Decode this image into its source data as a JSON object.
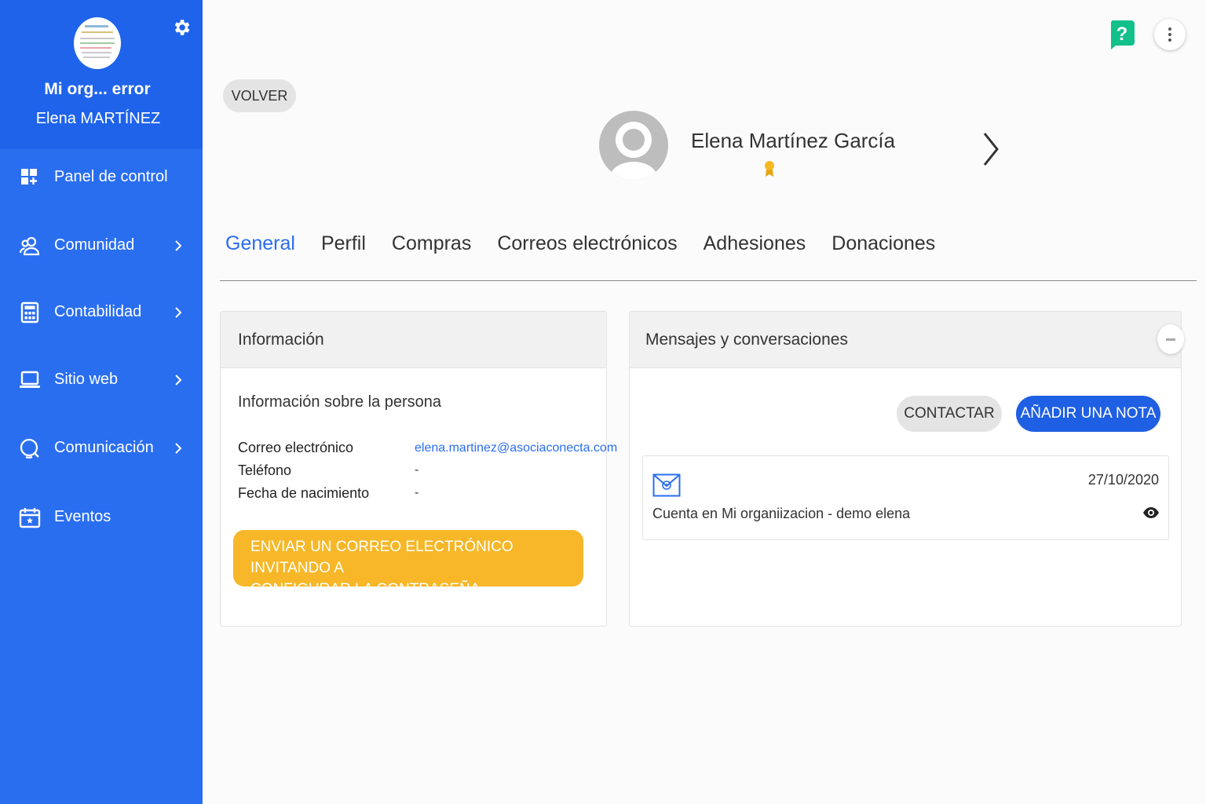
{
  "sidebar": {
    "org_name": "Mi org... error",
    "user_name": "Elena MARTÍNEZ",
    "items": [
      {
        "label": "Panel de control",
        "icon": "dashboard-icon",
        "has_submenu": false
      },
      {
        "label": "Comunidad",
        "icon": "users-icon",
        "has_submenu": true
      },
      {
        "label": "Contabilidad",
        "icon": "calculator-icon",
        "has_submenu": true
      },
      {
        "label": "Sitio web",
        "icon": "laptop-icon",
        "has_submenu": true
      },
      {
        "label": "Comunicación",
        "icon": "chat-icon",
        "has_submenu": true
      },
      {
        "label": "Eventos",
        "icon": "calendar-icon",
        "has_submenu": false
      }
    ]
  },
  "topbar": {
    "help_label": "?"
  },
  "header": {
    "back_label": "VOLVER",
    "person_name": "Elena Martínez García"
  },
  "tabs": [
    {
      "label": "General",
      "active": true
    },
    {
      "label": "Perfil",
      "active": false
    },
    {
      "label": "Compras",
      "active": false
    },
    {
      "label": "Correos electrónicos",
      "active": false
    },
    {
      "label": "Adhesiones",
      "active": false
    },
    {
      "label": "Donaciones",
      "active": false
    }
  ],
  "info_card": {
    "title": "Información",
    "subtitle": "Información sobre la persona",
    "rows": [
      {
        "label": "Correo electrónico",
        "value": "elena.martinez@asociaconecta.com"
      },
      {
        "label": "Teléfono",
        "value": "-"
      },
      {
        "label": "Fecha de nacimiento",
        "value": "-"
      }
    ],
    "invite_line1": "ENVIAR UN CORREO ELECTRÓNICO INVITANDO A",
    "invite_line2": "CONFIGURAR LA CONTRASEÑA"
  },
  "messages_card": {
    "title": "Mensajes y conversaciones",
    "contact_label": "CONTACTAR",
    "add_note_label": "AÑADIR UNA NOTA",
    "items": [
      {
        "date": "27/10/2020",
        "text": "Cuenta en Mi organiizacion - demo elena"
      }
    ]
  },
  "colors": {
    "sidebar": "#2a6ef0",
    "accent": "#2a6ef0",
    "primary_button": "#1f5fe3",
    "warning_button": "#f7b728",
    "help": "#12c08a"
  }
}
